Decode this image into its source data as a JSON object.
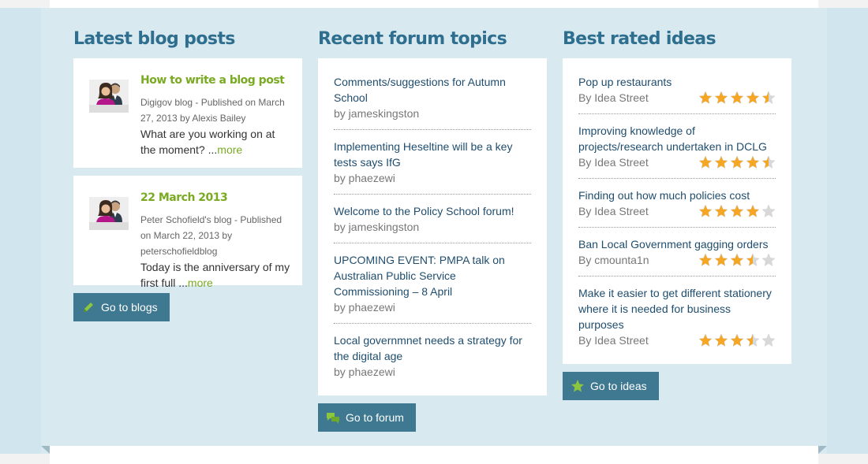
{
  "blogs": {
    "heading": "Latest blog posts",
    "posts": [
      {
        "title": "How to write a blog post",
        "meta": "Digigov blog - Published on March 27, 2013 by Alexis Bailey",
        "excerpt": "What are you working on at the moment? ...",
        "more": "more"
      },
      {
        "title": "22 March 2013",
        "meta": "Peter Schofield's blog - Published on March 22, 2013 by peterschofieldblog",
        "excerpt": "Today is the anniversary of my first full ...",
        "more": "more"
      }
    ],
    "button": "Go to blogs"
  },
  "forum": {
    "heading": "Recent forum topics",
    "topics": [
      {
        "title": "Comments/suggestions for Autumn School",
        "by": "by  jameskingston"
      },
      {
        "title": "Implementing Heseltine will be a key tests says IfG",
        "by": "by  phaezewi"
      },
      {
        "title": "Welcome to the Policy School forum!",
        "by": "by  jameskingston"
      },
      {
        "title": "UPCOMING EVENT: PMPA talk on Australian Public Service Commissioning – 8 April",
        "by": "by  phaezewi"
      },
      {
        "title": "Local governmnet needs a strategy for the digital age",
        "by": "by  phaezewi"
      }
    ],
    "button": "Go to forum"
  },
  "ideas": {
    "heading": "Best rated ideas",
    "items": [
      {
        "title": "Pop up restaurants",
        "by": "By Idea Street",
        "rating": 4.5
      },
      {
        "title": "Improving knowledge of projects/research undertaken in DCLG",
        "by": "By Idea Street",
        "rating": 4.5
      },
      {
        "title": "Finding out how much policies cost",
        "by": "By Idea Street",
        "rating": 4
      },
      {
        "title": "Ban Local Government gagging orders",
        "by": "By cmounta1n",
        "rating": 3.5
      },
      {
        "title": "Make it easier to get different stationery where it is needed for business purposes",
        "by": "By Idea Street",
        "rating": 3.5
      }
    ],
    "button": "Go to ideas"
  },
  "colors": {
    "heading": "#2e6e8e",
    "link_green": "#7aaa22",
    "button": "#3f7891",
    "band": "#d8e9f0",
    "star_full": "#f5a623",
    "star_empty": "#d8d8d8"
  },
  "icons": {
    "blogs_button": "pencil-icon",
    "forum_button": "speech-bubbles-icon",
    "ideas_button": "star-icon",
    "avatar": "users-avatar-icon"
  }
}
